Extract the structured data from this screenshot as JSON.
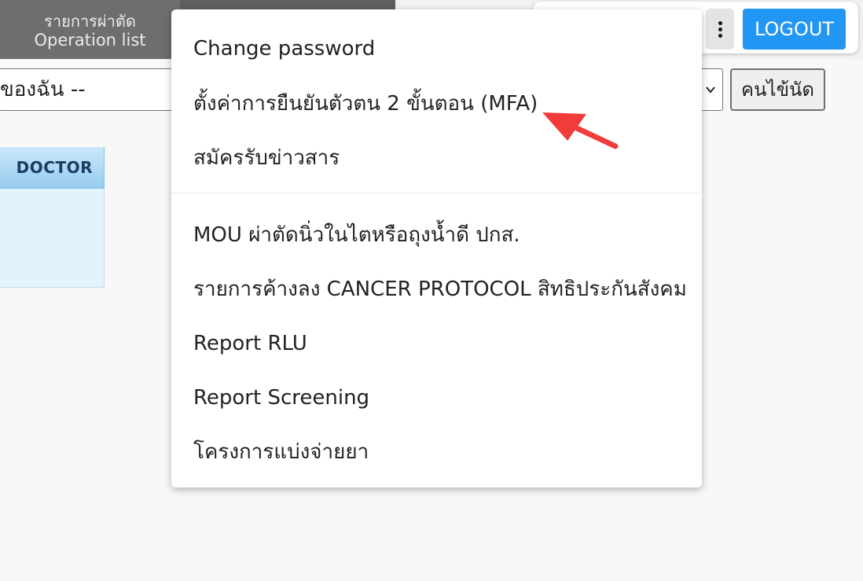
{
  "header": {
    "operation_tab": {
      "thai_label": "รายการผ่าตัด",
      "english_label": "Operation list"
    },
    "logout_label": "LOGOUT",
    "more_menu_icon": "kebab-vertical-icon",
    "logout_color": "#2196f3"
  },
  "filter": {
    "selected_value": "ของฉัน --",
    "appointment_button_label": "คนไข้นัด"
  },
  "table": {
    "columns": [
      "DOCTOR"
    ],
    "header_color": "#9ccef2"
  },
  "menu": {
    "items": [
      {
        "label": "Change password"
      },
      {
        "label": "ตั้งค่าการยืนยันตัวตน 2 ขั้นตอน (MFA)"
      },
      {
        "label": "สมัครรับข่าวสาร"
      },
      {
        "label": "MOU ผ่าตัดนิ่วในไตหรือถุงน้ำดี ปกส."
      },
      {
        "label": "รายการค้างลง CANCER PROTOCOL สิทธิประกันสังคม"
      },
      {
        "label": "Report RLU"
      },
      {
        "label": "Report Screening"
      },
      {
        "label": "โครงการแบ่งจ่ายยา"
      }
    ]
  },
  "annotation": {
    "arrow_color": "#f23b3b",
    "points_to": "menu-item-mfa"
  }
}
